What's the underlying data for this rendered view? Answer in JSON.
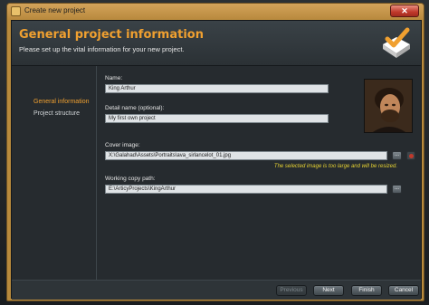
{
  "window": {
    "title": "Create new project",
    "close_label": "✕"
  },
  "header": {
    "title": "General project information",
    "subtitle": "Please set up the vital information for your new project."
  },
  "nav": {
    "items": [
      {
        "label": "General information",
        "active": true
      },
      {
        "label": "Project structure",
        "active": false
      }
    ]
  },
  "form": {
    "name": {
      "label": "Name:",
      "value": "King Arthur"
    },
    "detail_name": {
      "label": "Detail name (optional):",
      "value": "My first own project"
    },
    "cover_image": {
      "label": "Cover image:",
      "value": "X:\\Galahad\\Assets\\Portraits\\ava_sirlancelot_01.jpg",
      "browse_label": "...",
      "warning": "The selected image is too large and will be resized."
    },
    "working_copy": {
      "label": "Working copy path:",
      "value": "E:\\ArticyProjects\\KingArthur",
      "browse_label": "..."
    }
  },
  "footer": {
    "previous": "Previous",
    "next": "Next",
    "finish": "Finish",
    "cancel": "Cancel"
  },
  "colors": {
    "accent": "#f0a030",
    "window_frame": "#b88a3c",
    "warning": "#e6d232"
  }
}
